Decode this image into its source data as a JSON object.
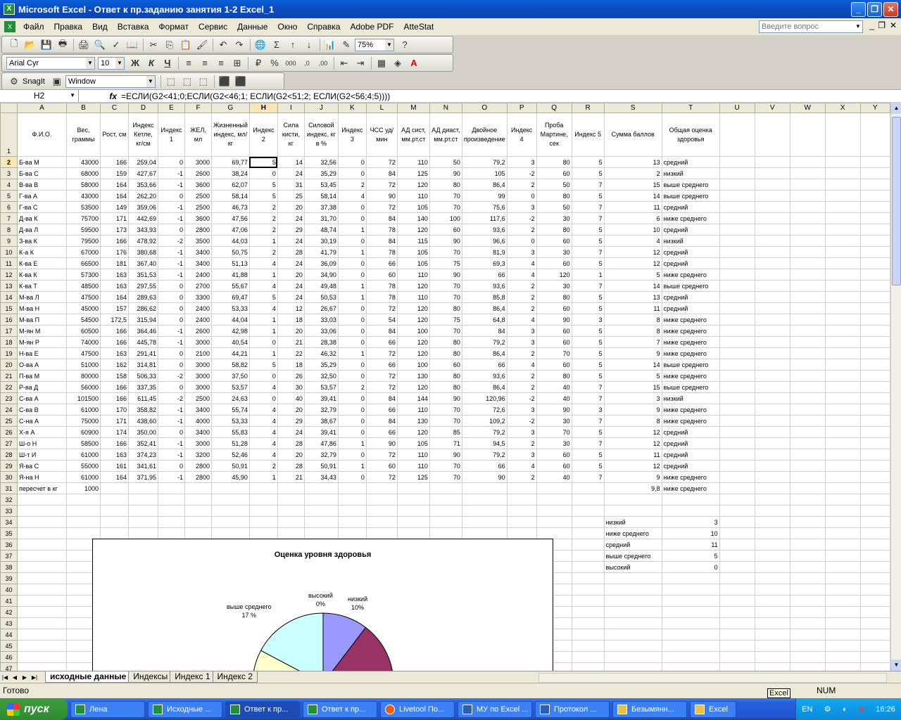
{
  "window": {
    "title": "Microsoft Excel - Ответ к пр.заданию занятия 1-2 Excel_1"
  },
  "menu": {
    "items": [
      "Файл",
      "Правка",
      "Вид",
      "Вставка",
      "Формат",
      "Сервис",
      "Данные",
      "Окно",
      "Справка",
      "Adobe PDF",
      "AtteStat"
    ],
    "help_placeholder": "Введите вопрос"
  },
  "toolbar": {
    "zoom": "75%",
    "font": "Arial Cyr",
    "size": "10",
    "snagit": "SnagIt",
    "window": "Window"
  },
  "formula": {
    "cell": "H2",
    "fx": "fx",
    "text": "=ЕСЛИ(G2<41;0;ЕСЛИ(G2<46;1; ЕСЛИ(G2<51;2; ЕСЛИ(G2<56;4;5))))"
  },
  "columns": [
    "A",
    "B",
    "C",
    "D",
    "E",
    "F",
    "G",
    "H",
    "I",
    "J",
    "K",
    "L",
    "M",
    "N",
    "O",
    "P",
    "Q",
    "R",
    "S",
    "T",
    "U",
    "V",
    "W",
    "X",
    "Y"
  ],
  "headers": [
    "Ф.И.О.",
    "Вес, граммы",
    "Рост, см",
    "Индекс Кетле, кг/см",
    "Индекс 1",
    "ЖЕЛ, мл",
    "Жизненный индекс, мл/кг",
    "Индекс 2",
    "Сила кисти, кг",
    "Силовой индекс, кг в %",
    "Индекс 3",
    "ЧСС уд/мин",
    "АД сист, мм.рт.ст",
    "АД диаст, мм.рт.ст",
    "Двойное произведение",
    "Индекс 4",
    "Проба Мартине, сек",
    "Индекс 5",
    "Сумма баллов",
    "Общая оценка здоровья"
  ],
  "rows": [
    [
      "Б-ва М",
      "43000",
      "166",
      "259,04",
      "0",
      "3000",
      "69,77",
      "5",
      "14",
      "32,56",
      "0",
      "72",
      "110",
      "50",
      "79,2",
      "3",
      "80",
      "5",
      "13",
      "средний"
    ],
    [
      "Б-ва С",
      "68000",
      "159",
      "427,67",
      "-1",
      "2600",
      "38,24",
      "0",
      "24",
      "35,29",
      "0",
      "84",
      "125",
      "90",
      "105",
      "-2",
      "60",
      "5",
      "2",
      "низкий"
    ],
    [
      "В-ва В",
      "58000",
      "164",
      "353,66",
      "-1",
      "3600",
      "62,07",
      "5",
      "31",
      "53,45",
      "2",
      "72",
      "120",
      "80",
      "86,4",
      "2",
      "50",
      "7",
      "15",
      "выше среднего"
    ],
    [
      "Г-ва А",
      "43000",
      "164",
      "262,20",
      "0",
      "2500",
      "58,14",
      "5",
      "25",
      "58,14",
      "4",
      "90",
      "110",
      "70",
      "99",
      "0",
      "80",
      "5",
      "14",
      "выше среднего"
    ],
    [
      "Г-ва С",
      "53500",
      "149",
      "359,06",
      "-1",
      "2500",
      "46,73",
      "2",
      "20",
      "37,38",
      "0",
      "72",
      "105",
      "70",
      "75,6",
      "3",
      "50",
      "7",
      "11",
      "средний"
    ],
    [
      "Д-ва К",
      "75700",
      "171",
      "442,69",
      "-1",
      "3600",
      "47,56",
      "2",
      "24",
      "31,70",
      "0",
      "84",
      "140",
      "100",
      "117,6",
      "-2",
      "30",
      "7",
      "6",
      "ниже среднего"
    ],
    [
      "Д-ва Л",
      "59500",
      "173",
      "343,93",
      "0",
      "2800",
      "47,06",
      "2",
      "29",
      "48,74",
      "1",
      "78",
      "120",
      "60",
      "93,6",
      "2",
      "80",
      "5",
      "10",
      "средний"
    ],
    [
      "З-ва К",
      "79500",
      "166",
      "478,92",
      "-2",
      "3500",
      "44,03",
      "1",
      "24",
      "30,19",
      "0",
      "84",
      "115",
      "90",
      "96,6",
      "0",
      "60",
      "5",
      "4",
      "низкий"
    ],
    [
      "К-а К",
      "67000",
      "176",
      "380,68",
      "-1",
      "3400",
      "50,75",
      "2",
      "28",
      "41,79",
      "1",
      "78",
      "105",
      "70",
      "81,9",
      "3",
      "30",
      "7",
      "12",
      "средний"
    ],
    [
      "К-ва Е",
      "66500",
      "181",
      "367,40",
      "-1",
      "3400",
      "51,13",
      "4",
      "24",
      "36,09",
      "0",
      "66",
      "105",
      "75",
      "69,3",
      "4",
      "60",
      "5",
      "12",
      "средний"
    ],
    [
      "К-ва К",
      "57300",
      "163",
      "351,53",
      "-1",
      "2400",
      "41,88",
      "1",
      "20",
      "34,90",
      "0",
      "60",
      "110",
      "90",
      "66",
      "4",
      "120",
      "1",
      "5",
      "ниже среднего"
    ],
    [
      "К-ва Т",
      "48500",
      "163",
      "297,55",
      "0",
      "2700",
      "55,67",
      "4",
      "24",
      "49,48",
      "1",
      "78",
      "120",
      "70",
      "93,6",
      "2",
      "30",
      "7",
      "14",
      "выше среднего"
    ],
    [
      "М-ва Л",
      "47500",
      "164",
      "289,63",
      "0",
      "3300",
      "69,47",
      "5",
      "24",
      "50,53",
      "1",
      "78",
      "110",
      "70",
      "85,8",
      "2",
      "80",
      "5",
      "13",
      "средний"
    ],
    [
      "М-ва Н",
      "45000",
      "157",
      "286,62",
      "0",
      "2400",
      "53,33",
      "4",
      "12",
      "26,67",
      "0",
      "72",
      "120",
      "80",
      "86,4",
      "2",
      "60",
      "5",
      "11",
      "средний"
    ],
    [
      "М-ва П",
      "54500",
      "172,5",
      "315,94",
      "0",
      "2400",
      "44,04",
      "1",
      "18",
      "33,03",
      "0",
      "54",
      "120",
      "75",
      "64,8",
      "4",
      "90",
      "3",
      "8",
      "ниже среднего"
    ],
    [
      "М-ян М",
      "60500",
      "166",
      "364,46",
      "-1",
      "2600",
      "42,98",
      "1",
      "20",
      "33,06",
      "0",
      "84",
      "100",
      "70",
      "84",
      "3",
      "60",
      "5",
      "8",
      "ниже среднего"
    ],
    [
      "М-ян Р",
      "74000",
      "166",
      "445,78",
      "-1",
      "3000",
      "40,54",
      "0",
      "21",
      "28,38",
      "0",
      "66",
      "120",
      "80",
      "79,2",
      "3",
      "60",
      "5",
      "7",
      "ниже среднего"
    ],
    [
      "Н-ва Е",
      "47500",
      "163",
      "291,41",
      "0",
      "2100",
      "44,21",
      "1",
      "22",
      "46,32",
      "1",
      "72",
      "120",
      "80",
      "86,4",
      "2",
      "70",
      "5",
      "9",
      "ниже среднего"
    ],
    [
      "О-ва А",
      "51000",
      "162",
      "314,81",
      "0",
      "3000",
      "58,82",
      "5",
      "18",
      "35,29",
      "0",
      "66",
      "100",
      "60",
      "66",
      "4",
      "60",
      "5",
      "14",
      "выше среднего"
    ],
    [
      "П-ва М",
      "80000",
      "158",
      "506,33",
      "-2",
      "3000",
      "37,50",
      "0",
      "26",
      "32,50",
      "0",
      "72",
      "130",
      "80",
      "93,6",
      "2",
      "80",
      "5",
      "5",
      "ниже среднего"
    ],
    [
      "Р-ва Д",
      "56000",
      "166",
      "337,35",
      "0",
      "3000",
      "53,57",
      "4",
      "30",
      "53,57",
      "2",
      "72",
      "120",
      "80",
      "86,4",
      "2",
      "40",
      "7",
      "15",
      "выше среднего"
    ],
    [
      "С-ва А",
      "101500",
      "166",
      "611,45",
      "-2",
      "2500",
      "24,63",
      "0",
      "40",
      "39,41",
      "0",
      "84",
      "144",
      "90",
      "120,96",
      "-2",
      "40",
      "7",
      "3",
      "низкий"
    ],
    [
      "С-ва В",
      "61000",
      "170",
      "358,82",
      "-1",
      "3400",
      "55,74",
      "4",
      "20",
      "32,79",
      "0",
      "66",
      "110",
      "70",
      "72,6",
      "3",
      "90",
      "3",
      "9",
      "ниже среднего"
    ],
    [
      "С-на А",
      "75000",
      "171",
      "438,60",
      "-1",
      "4000",
      "53,33",
      "4",
      "29",
      "38,67",
      "0",
      "84",
      "130",
      "70",
      "109,2",
      "-2",
      "30",
      "7",
      "8",
      "ниже среднего"
    ],
    [
      "Х-я А",
      "60900",
      "174",
      "350,00",
      "0",
      "3400",
      "55,83",
      "4",
      "24",
      "39,41",
      "0",
      "66",
      "120",
      "85",
      "79,2",
      "3",
      "70",
      "5",
      "12",
      "средний"
    ],
    [
      "Ш-о Н",
      "58500",
      "166",
      "352,41",
      "-1",
      "3000",
      "51,28",
      "4",
      "28",
      "47,86",
      "1",
      "90",
      "105",
      "71",
      "94,5",
      "2",
      "30",
      "7",
      "12",
      "средний"
    ],
    [
      "Ш-т И",
      "61000",
      "163",
      "374,23",
      "-1",
      "3200",
      "52,46",
      "4",
      "20",
      "32,79",
      "0",
      "72",
      "110",
      "90",
      "79,2",
      "3",
      "60",
      "5",
      "11",
      "средний"
    ],
    [
      "Я-ва С",
      "55000",
      "161",
      "341,61",
      "0",
      "2800",
      "50,91",
      "2",
      "28",
      "50,91",
      "1",
      "60",
      "110",
      "70",
      "66",
      "4",
      "60",
      "5",
      "12",
      "средний"
    ],
    [
      "Я-на Н",
      "61000",
      "164",
      "371,95",
      "-1",
      "2800",
      "45,90",
      "1",
      "21",
      "34,43",
      "0",
      "72",
      "125",
      "70",
      "90",
      "2",
      "40",
      "7",
      "9",
      "ниже среднего"
    ]
  ],
  "row31": {
    "label": "пересчет в кг",
    "value": "1000",
    "avg": "9,8",
    "grade": "ниже среднего"
  },
  "summary": [
    {
      "label": "низкий",
      "count": "3"
    },
    {
      "label": "ниже среднего",
      "count": "10"
    },
    {
      "label": "средний",
      "count": "11"
    },
    {
      "label": "выше среднего",
      "count": "5"
    },
    {
      "label": "высокий",
      "count": "0"
    }
  ],
  "chart_data": {
    "type": "pie",
    "title": "Оценка уровня здоровья",
    "categories": [
      "низкий",
      "ниже среднего",
      "средний",
      "выше среднего",
      "высокий"
    ],
    "values": [
      3,
      10,
      11,
      5,
      0
    ],
    "visible_labels": [
      {
        "name": "выше среднего",
        "pct": "17 %"
      },
      {
        "name": "высокий",
        "pct": "0%"
      },
      {
        "name": "низкий",
        "pct": "10%"
      }
    ],
    "colors": [
      "#9999ff",
      "#993366",
      "#ffffcc",
      "#ccffff",
      "#660066"
    ]
  },
  "sheets": [
    "исходные данные",
    "Индексы",
    "Индекс 1",
    "Индекс 2"
  ],
  "status": {
    "ready": "Готово",
    "num": "NUM",
    "tooltip": "Excel"
  },
  "taskbar": {
    "start": "пуск",
    "tasks": [
      "Лена",
      "Исходные ...",
      "Ответ к пр...",
      "Ответ к пр...",
      "Livetool По...",
      "МУ по Excel ...",
      "Протокол ...",
      "Безымянн...",
      "Excel"
    ],
    "lang": "EN",
    "clock": "16:26"
  }
}
